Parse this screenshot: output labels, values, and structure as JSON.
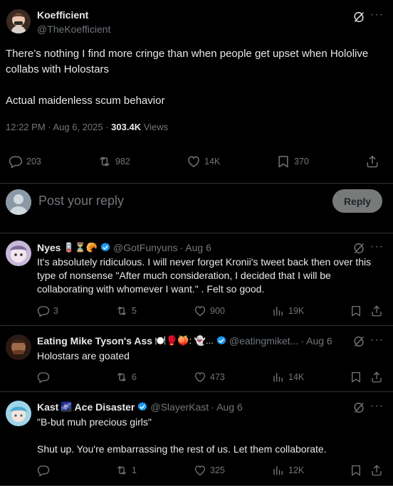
{
  "main_tweet": {
    "author_name": "Koefficient",
    "author_handle": "@TheKoefficient",
    "text": "There’s nothing  I find more cringe than when people get upset when Hololive collabs with Holostars\n\nActual maidenless scum behavior",
    "timestamp": "12:22 PM · Aug 6, 2025 · ",
    "views_count": "303.4K",
    "views_label": " Views",
    "stats": {
      "replies": "203",
      "reposts": "982",
      "likes": "14K",
      "bookmarks": "370"
    }
  },
  "reply_box": {
    "placeholder": "Post your reply",
    "button_label": "Reply"
  },
  "replies": [
    {
      "name": "Nyes",
      "name_emojis": "🪫⏳🥐",
      "handle": "@GotFunyuns",
      "date": "· Aug 6",
      "text": "It's absolutely ridiculous. I will never forget Kronii's tweet back then over this type of nonsense \"After much consideration, I decided that I will be collaborating with whomever I want.\" . Felt so good.",
      "replies": "3",
      "reposts": "5",
      "likes": "900",
      "views": "19K"
    },
    {
      "name": "Eating Mike Tyson's Ass",
      "name_emojis": "🍽️🥊🍑: 👻...",
      "handle": "@eatingmiket...",
      "date": "· Aug 6",
      "text": "Holostars are goated",
      "replies": "",
      "reposts": "6",
      "likes": "473",
      "views": "14K"
    },
    {
      "name": "Kast",
      "name_emojis": "🌌",
      "name_suffix": "Ace Disaster",
      "handle": "@SlayerKast",
      "date": "· Aug 6",
      "text": "\"B-but muh precious girls\"\n\nShut up. You're embarrassing the rest of us. Let them collaborate.",
      "replies": "",
      "reposts": "1",
      "likes": "325",
      "views": "12K"
    }
  ],
  "colors": {
    "background": "#000000",
    "text": "#e7e9ea",
    "secondary": "#71767b",
    "divider": "#2f3336",
    "verified": "#1d9bf0"
  },
  "icons": [
    "reply-icon",
    "repost-icon",
    "like-icon",
    "bookmark-icon",
    "share-icon",
    "views-icon",
    "grok-icon",
    "more-icon",
    "verified-icon"
  ]
}
